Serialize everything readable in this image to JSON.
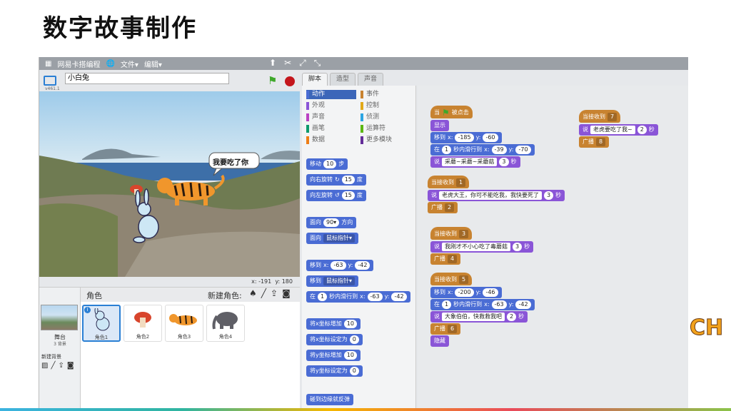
{
  "slide": {
    "title": "数字故事制作",
    "deco_text": "CH"
  },
  "menubar": {
    "app_name": "网易卡搭编程",
    "file": "文件▾",
    "edit": "编辑▾"
  },
  "stage": {
    "version": "v461.1",
    "project_name": "小白兔",
    "speech": "我要吃了你",
    "coords_x_label": "x:",
    "coords_x": "-191",
    "coords_y_label": "y:",
    "coords_y": "180"
  },
  "sprites": {
    "header": "角色",
    "new_sprite": "新建角色:",
    "stage_label": "舞台",
    "stage_backdrops": "3 背景",
    "new_backdrop": "新建背景",
    "items": [
      "角色1",
      "角色2",
      "角色3",
      "角色4"
    ]
  },
  "tabs": [
    "脚本",
    "造型",
    "声音"
  ],
  "categories": [
    {
      "label": "动作",
      "color": "#4a6cd4"
    },
    {
      "label": "外观",
      "color": "#8a55d7"
    },
    {
      "label": "声音",
      "color": "#bb42c3"
    },
    {
      "label": "画笔",
      "color": "#0e9a6c"
    },
    {
      "label": "数据",
      "color": "#ee7d16"
    },
    {
      "label": "事件",
      "color": "#c88330"
    },
    {
      "label": "控制",
      "color": "#e1a91a"
    },
    {
      "label": "侦测",
      "color": "#2ca5e2"
    },
    {
      "label": "运算符",
      "color": "#5cb712"
    },
    {
      "label": "更多模块",
      "color": "#632d99"
    }
  ],
  "palette": {
    "move": "移动",
    "move_n": "10",
    "steps": "步",
    "turn_right": "向右旋转",
    "turn_right_n": "15",
    "deg": "度",
    "turn_left": "向左旋转",
    "turn_left_n": "15",
    "point_dir": "面向",
    "point_dir_n": "90▾",
    "direction": "方向",
    "point_towards": "面向",
    "mouse_ptr": "鼠标指针▾",
    "goto_xy": "移到",
    "x": "x:",
    "y": "y:",
    "gx": "-63",
    "gy": "-42",
    "goto": "移到",
    "glide": "在",
    "glide_n": "1",
    "glide_txt": "秒内滑行到",
    "glx": "-63",
    "gly": "-42",
    "change_x": "将x坐标增加",
    "change_x_n": "10",
    "set_x": "将x坐标设定为",
    "set_x_n": "0",
    "change_y": "将y坐标增加",
    "change_y_n": "10",
    "set_y": "将y坐标设定为",
    "set_y_n": "0",
    "bounce": "碰到边缘就反弹"
  },
  "script": {
    "when": "当",
    "clicked": "被点击",
    "show": "显示",
    "goto": "移到",
    "x": "x:",
    "y": "y:",
    "x1": "-185",
    "y1": "-60",
    "glide_in": "在",
    "sec_glide": "秒内滑行到",
    "g1n": "1",
    "g1x": "-39",
    "g1y": "-70",
    "say": "说",
    "say1": "采蘑~采蘑~采蘑菇",
    "s1": "3",
    "sec": "秒",
    "recv": "当接收到",
    "r1": "1",
    "say2": "老虎大王，你可不能吃我，我快要死了",
    "s2": "3",
    "bc": "广播",
    "b2": "2",
    "r3": "3",
    "say3": "我刚才不小心吃了毒蘑菇",
    "s3": "3",
    "b4": "4",
    "r5": "5",
    "x5": "-200",
    "y5": "-46",
    "g5n": "1",
    "g5x": "-63",
    "g5y": "-42",
    "say5": "大象伯伯，快救救我吧",
    "s5": "2",
    "b6": "6",
    "hide": "隐藏",
    "r7": "7",
    "say7": "老虎要吃了我~",
    "s7": "2",
    "b8": "8"
  }
}
